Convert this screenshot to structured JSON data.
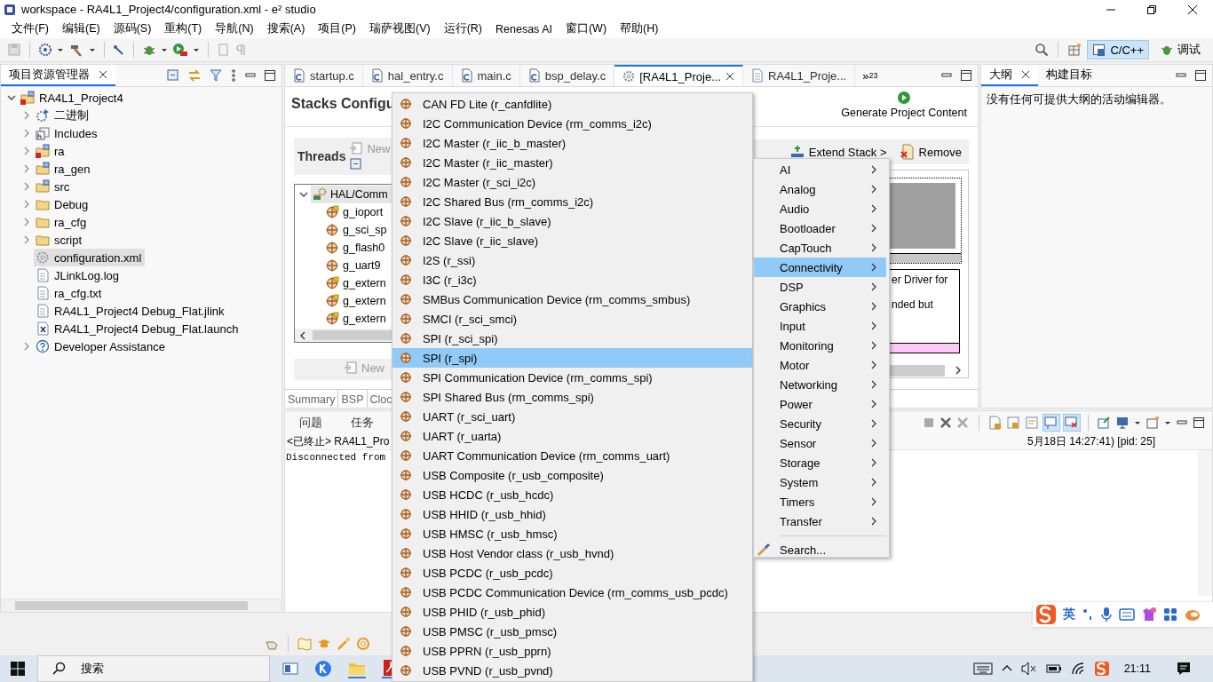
{
  "window": {
    "title": "workspace - RA4L1_Project4/configuration.xml - e² studio"
  },
  "menu_bar": [
    "文件(F)",
    "编辑(E)",
    "源码(S)",
    "重构(T)",
    "导航(N)",
    "搜索(A)",
    "项目(P)",
    "瑞萨视图(V)",
    "运行(R)",
    "Renesas AI",
    "窗口(W)",
    "帮助(H)"
  ],
  "perspectives": [
    {
      "label": "C/C++",
      "selected": true
    },
    {
      "label": "调试",
      "selected": false
    }
  ],
  "project_explorer": {
    "tab": "项目资源管理器",
    "tree": [
      {
        "label": "RA4L1_Project4",
        "kind": "project",
        "expanded": true,
        "selected": false,
        "children": [
          {
            "label": "二进制",
            "kind": "binaries",
            "expanded": false,
            "selected": false
          },
          {
            "label": "Includes",
            "kind": "includes",
            "expanded": false,
            "selected": false
          },
          {
            "label": "ra",
            "kind": "source_error",
            "expanded": false,
            "selected": false
          },
          {
            "label": "ra_gen",
            "kind": "source",
            "expanded": false,
            "selected": false
          },
          {
            "label": "src",
            "kind": "source",
            "expanded": false,
            "selected": false
          },
          {
            "label": "Debug",
            "kind": "folder",
            "expanded": false,
            "selected": false
          },
          {
            "label": "ra_cfg",
            "kind": "folder",
            "expanded": false,
            "selected": false
          },
          {
            "label": "script",
            "kind": "folder",
            "expanded": false,
            "selected": false
          },
          {
            "label": "configuration.xml",
            "kind": "config",
            "selected": true
          },
          {
            "label": "JLinkLog.log",
            "kind": "file",
            "selected": false
          },
          {
            "label": "ra_cfg.txt",
            "kind": "file",
            "selected": false
          },
          {
            "label": "RA4L1_Project4 Debug_Flat.jlink",
            "kind": "file",
            "selected": false
          },
          {
            "label": "RA4L1_Project4 Debug_Flat.launch",
            "kind": "launch",
            "selected": false
          },
          {
            "label": "Developer Assistance",
            "kind": "help",
            "expanded": false,
            "selected": false
          }
        ]
      }
    ]
  },
  "editor_tabs": [
    {
      "label": "startup.c",
      "kind": "c",
      "selected": false
    },
    {
      "label": "hal_entry.c",
      "kind": "c",
      "selected": false
    },
    {
      "label": "main.c",
      "kind": "c",
      "selected": false
    },
    {
      "label": "bsp_delay.c",
      "kind": "c",
      "selected": false
    },
    {
      "label": "[RA4L1_Proje...",
      "kind": "config",
      "selected": true
    },
    {
      "label": "RA4L1_Proje...",
      "kind": "file",
      "selected": false
    }
  ],
  "editor_overflow": {
    "symbol": "»",
    "count": "23"
  },
  "editor": {
    "title": "Stacks Configu",
    "generate_button": "Generate Project Content",
    "threads": {
      "title": "Threads",
      "new_button": "New",
      "tree": [
        {
          "label": "HAL/Comm",
          "kind": "stack",
          "expanded": true,
          "selected": true,
          "children": [
            {
              "label": "g_ioport",
              "kind": "module_pin",
              "selected": false
            },
            {
              "label": "g_sci_sp",
              "kind": "module",
              "selected": false
            },
            {
              "label": "g_flash0",
              "kind": "module",
              "selected": false
            },
            {
              "label": "g_uart9",
              "kind": "module",
              "selected": false
            },
            {
              "label": "g_extern",
              "kind": "module_pin",
              "selected": false
            },
            {
              "label": "g_extern",
              "kind": "module_pin",
              "selected": false
            },
            {
              "label": "g_extern",
              "kind": "module_pin",
              "selected": false
            }
          ]
        }
      ]
    },
    "objects_new_button": "New",
    "stack_buttons": [
      "Extend Stack >",
      "Remove"
    ],
    "stack_block_lines": [
      "er Driver for",
      "nded but"
    ],
    "bottom_tabs": [
      "Summary",
      "BSP",
      "Cloc"
    ]
  },
  "outline": {
    "tabs": [
      {
        "label": "大纲",
        "selected": true
      },
      {
        "label": "构建目标",
        "selected": false
      }
    ],
    "message": "没有任何可提供大纲的活动编辑器。"
  },
  "console": {
    "tabs": [
      {
        "label": "问题",
        "selected": false
      },
      {
        "label": "任务",
        "selected": false
      }
    ],
    "header_left": "<已终止> RA4L1_Pro",
    "header_right": "5月18日 14:27:41) [pid: 25]",
    "lines": [
      "Disconnected from"
    ]
  },
  "component_menu": {
    "items": [
      {
        "label": "CAN FD Lite (r_canfdlite)",
        "selected": false
      },
      {
        "label": "I2C Communication Device (rm_comms_i2c)",
        "selected": false
      },
      {
        "label": "I2C Master (r_iic_b_master)",
        "selected": false
      },
      {
        "label": "I2C Master (r_iic_master)",
        "selected": false
      },
      {
        "label": "I2C Master (r_sci_i2c)",
        "selected": false
      },
      {
        "label": "I2C Shared Bus (rm_comms_i2c)",
        "selected": false
      },
      {
        "label": "I2C Slave (r_iic_b_slave)",
        "selected": false
      },
      {
        "label": "I2C Slave (r_iic_slave)",
        "selected": false
      },
      {
        "label": "I2S (r_ssi)",
        "selected": false
      },
      {
        "label": "I3C (r_i3c)",
        "selected": false
      },
      {
        "label": "SMBus Communication Device (rm_comms_smbus)",
        "selected": false
      },
      {
        "label": "SMCI (r_sci_smci)",
        "selected": false
      },
      {
        "label": "SPI (r_sci_spi)",
        "selected": false
      },
      {
        "label": "SPI (r_spi)",
        "selected": true
      },
      {
        "label": "SPI Communication Device (rm_comms_spi)",
        "selected": false
      },
      {
        "label": "SPI Shared Bus (rm_comms_spi)",
        "selected": false
      },
      {
        "label": "UART (r_sci_uart)",
        "selected": false
      },
      {
        "label": "UART (r_uarta)",
        "selected": false
      },
      {
        "label": "UART Communication Device (rm_comms_uart)",
        "selected": false
      },
      {
        "label": "USB Composite (r_usb_composite)",
        "selected": false
      },
      {
        "label": "USB HCDC (r_usb_hcdc)",
        "selected": false
      },
      {
        "label": "USB HHID (r_usb_hhid)",
        "selected": false
      },
      {
        "label": "USB HMSC (r_usb_hmsc)",
        "selected": false
      },
      {
        "label": "USB Host Vendor class (r_usb_hvnd)",
        "selected": false
      },
      {
        "label": "USB PCDC (r_usb_pcdc)",
        "selected": false
      },
      {
        "label": "USB PCDC Communication Device (rm_comms_usb_pcdc)",
        "selected": false
      },
      {
        "label": "USB PHID (r_usb_phid)",
        "selected": false
      },
      {
        "label": "USB PMSC (r_usb_pmsc)",
        "selected": false
      },
      {
        "label": "USB PPRN (r_usb_pprn)",
        "selected": false
      },
      {
        "label": "USB PVND (r_usb_pvnd)",
        "selected": false
      }
    ]
  },
  "category_menu": {
    "items": [
      {
        "label": "AI",
        "selected": false
      },
      {
        "label": "Analog",
        "selected": false
      },
      {
        "label": "Audio",
        "selected": false
      },
      {
        "label": "Bootloader",
        "selected": false
      },
      {
        "label": "CapTouch",
        "selected": false
      },
      {
        "label": "Connectivity",
        "selected": true
      },
      {
        "label": "DSP",
        "selected": false
      },
      {
        "label": "Graphics",
        "selected": false
      },
      {
        "label": "Input",
        "selected": false
      },
      {
        "label": "Monitoring",
        "selected": false
      },
      {
        "label": "Motor",
        "selected": false
      },
      {
        "label": "Networking",
        "selected": false
      },
      {
        "label": "Power",
        "selected": false
      },
      {
        "label": "Security",
        "selected": false
      },
      {
        "label": "Sensor",
        "selected": false
      },
      {
        "label": "Storage",
        "selected": false
      },
      {
        "label": "System",
        "selected": false
      },
      {
        "label": "Timers",
        "selected": false
      },
      {
        "label": "Transfer",
        "selected": false
      }
    ],
    "search": "Search..."
  },
  "ime_bar": {
    "mode": "英"
  },
  "taskbar": {
    "search": "搜索",
    "time": "21:11"
  }
}
